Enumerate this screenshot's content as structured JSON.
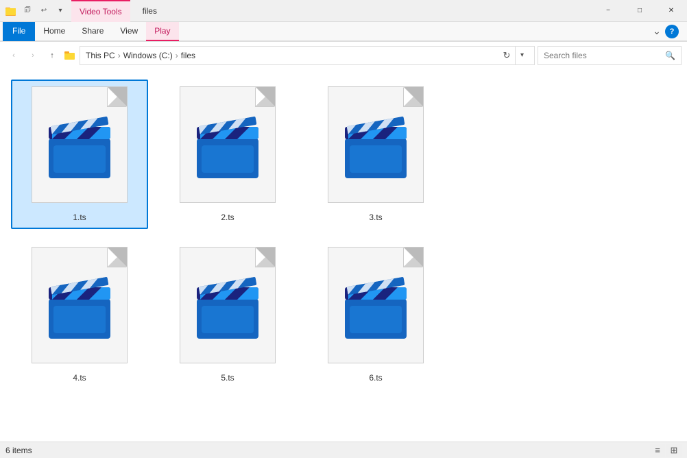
{
  "titleBar": {
    "title": "files",
    "videoToolsLabel": "Video Tools",
    "windowControls": {
      "minimize": "−",
      "maximize": "□",
      "close": "✕"
    }
  },
  "ribbon": {
    "tabs": [
      {
        "id": "file",
        "label": "File",
        "type": "file"
      },
      {
        "id": "home",
        "label": "Home"
      },
      {
        "id": "share",
        "label": "Share"
      },
      {
        "id": "view",
        "label": "View"
      },
      {
        "id": "play",
        "label": "Play",
        "type": "play"
      }
    ]
  },
  "addressBar": {
    "back": "‹",
    "forward": "›",
    "up": "↑",
    "pathParts": [
      "This PC",
      "Windows (C:)",
      "files"
    ],
    "refreshIcon": "↻",
    "dropdownIcon": "▾",
    "search": {
      "placeholder": "Search files",
      "icon": "🔍"
    }
  },
  "files": [
    {
      "name": "1.ts",
      "selected": true
    },
    {
      "name": "2.ts",
      "selected": false
    },
    {
      "name": "3.ts",
      "selected": false
    },
    {
      "name": "4.ts",
      "selected": false
    },
    {
      "name": "5.ts",
      "selected": false
    },
    {
      "name": "6.ts",
      "selected": false
    }
  ],
  "statusBar": {
    "itemCount": "6 items",
    "viewIcons": [
      "≡",
      "⊞"
    ]
  },
  "colors": {
    "accent": "#0078d7",
    "videoTabBg": "#fce4ec",
    "videoTabAccent": "#e91e63",
    "clapperBlue": "#1565c0",
    "clapperLightBlue": "#2196f3",
    "clapperStripe": "#fff"
  }
}
